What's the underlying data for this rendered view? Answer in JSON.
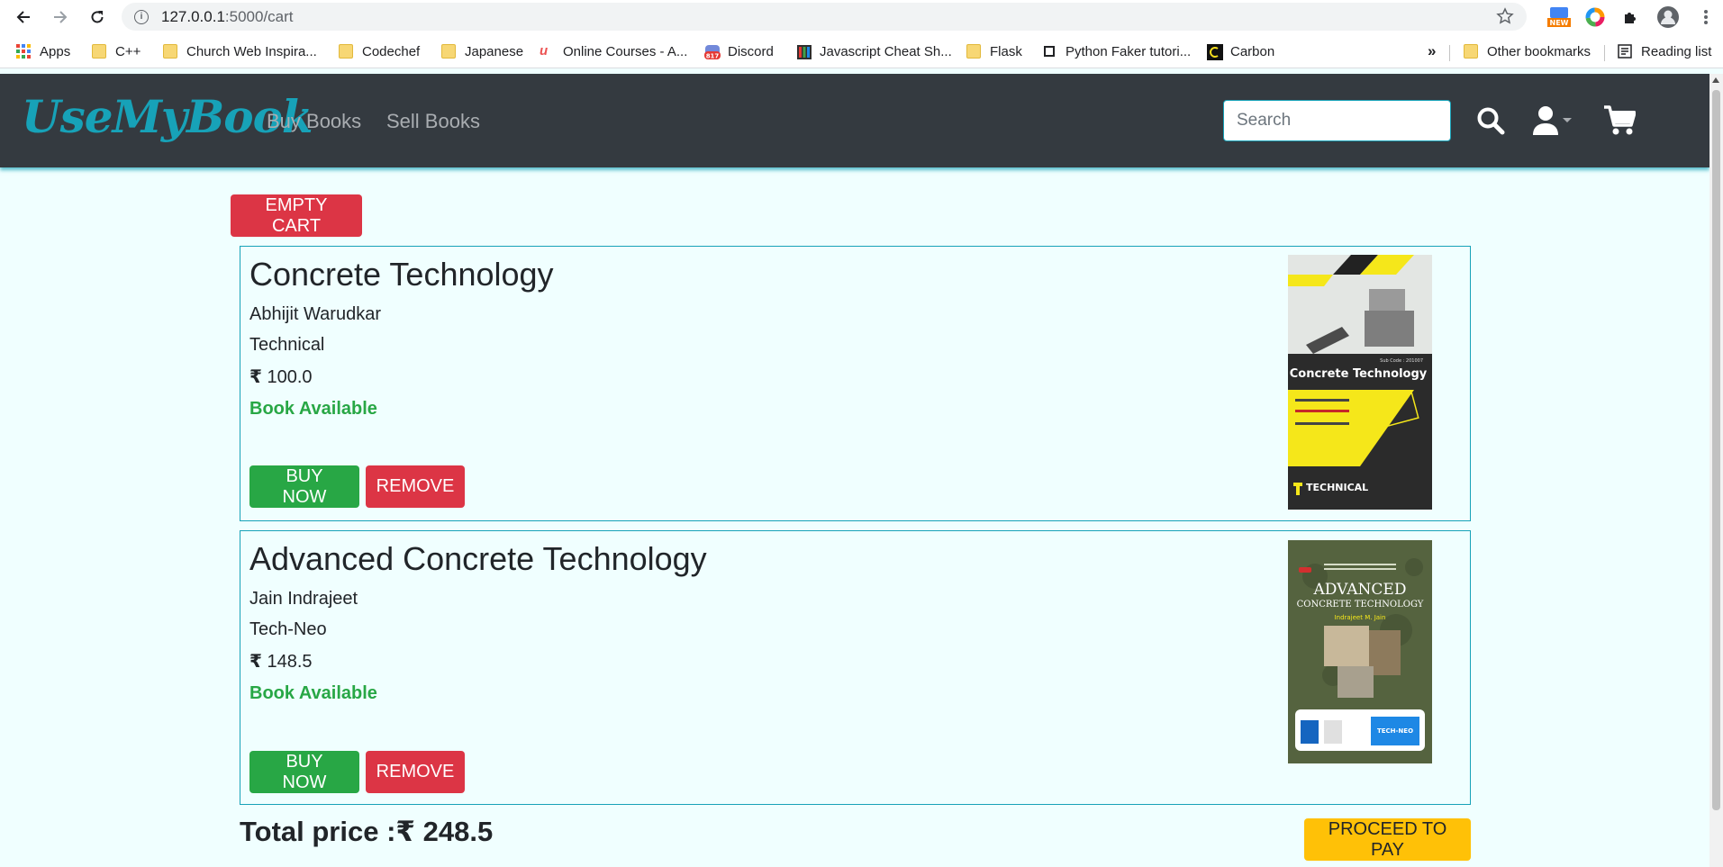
{
  "browser": {
    "url_host": "127.0.0.1",
    "url_path": ":5000/cart",
    "ext_new_badge": "NEW",
    "bookmarks": [
      {
        "label": "Apps",
        "icon": "apps-grid-icon"
      },
      {
        "label": "C++",
        "icon": "folder-icon"
      },
      {
        "label": "Church Web Inspira...",
        "icon": "folder-icon"
      },
      {
        "label": "Codechef",
        "icon": "folder-icon"
      },
      {
        "label": "Japanese",
        "icon": "folder-icon"
      },
      {
        "label": "Online Courses - A...",
        "icon": "udemy-icon"
      },
      {
        "label": "Discord",
        "icon": "discord-icon"
      },
      {
        "label": "Javascript Cheat Sh...",
        "icon": "book-icon"
      },
      {
        "label": "Flask",
        "icon": "folder-icon"
      },
      {
        "label": "Python Faker tutori...",
        "icon": "page-icon"
      },
      {
        "label": "Carbon",
        "icon": "carbon-icon"
      }
    ],
    "discord_badge": "817",
    "overflow": "»",
    "other_bookmarks": "Other bookmarks",
    "reading_list": "Reading list"
  },
  "navbar": {
    "brand": "UseMyBook",
    "links": [
      "Buy Books",
      "Sell Books"
    ],
    "search_placeholder": "Search"
  },
  "cart": {
    "empty_label": "EMPTY CART",
    "items": [
      {
        "title": "Concrete Technology",
        "author": "Abhijit Warudkar",
        "category": "Technical",
        "price": "100.0",
        "availability": "Book Available",
        "buy_label": "BUY NOW",
        "remove_label": "REMOVE",
        "cover": {
          "title": "Concrete Technology",
          "publisher": "TECHNICAL",
          "code": "Sub Code : 201007"
        }
      },
      {
        "title": "Advanced Concrete Technology",
        "author": "Jain Indrajeet",
        "category": "Tech-Neo",
        "price": "148.5",
        "availability": "Book Available",
        "buy_label": "BUY NOW",
        "remove_label": "REMOVE",
        "cover": {
          "title_line1": "ADVANCED",
          "title_line2": "CONCRETE TECHNOLOGY",
          "author": "Indrajeet M. Jain",
          "publisher": "TECH-NEO"
        }
      }
    ],
    "total_label": "Total price :",
    "currency": "₹",
    "total": "248.5",
    "proceed_label": "PROCEED TO PAY"
  },
  "colors": {
    "accent": "#17a2b8",
    "success": "#28a745",
    "danger": "#dc3545",
    "warning": "#ffc107",
    "navbar": "#343a40",
    "page_bg": "#f0ffff"
  }
}
